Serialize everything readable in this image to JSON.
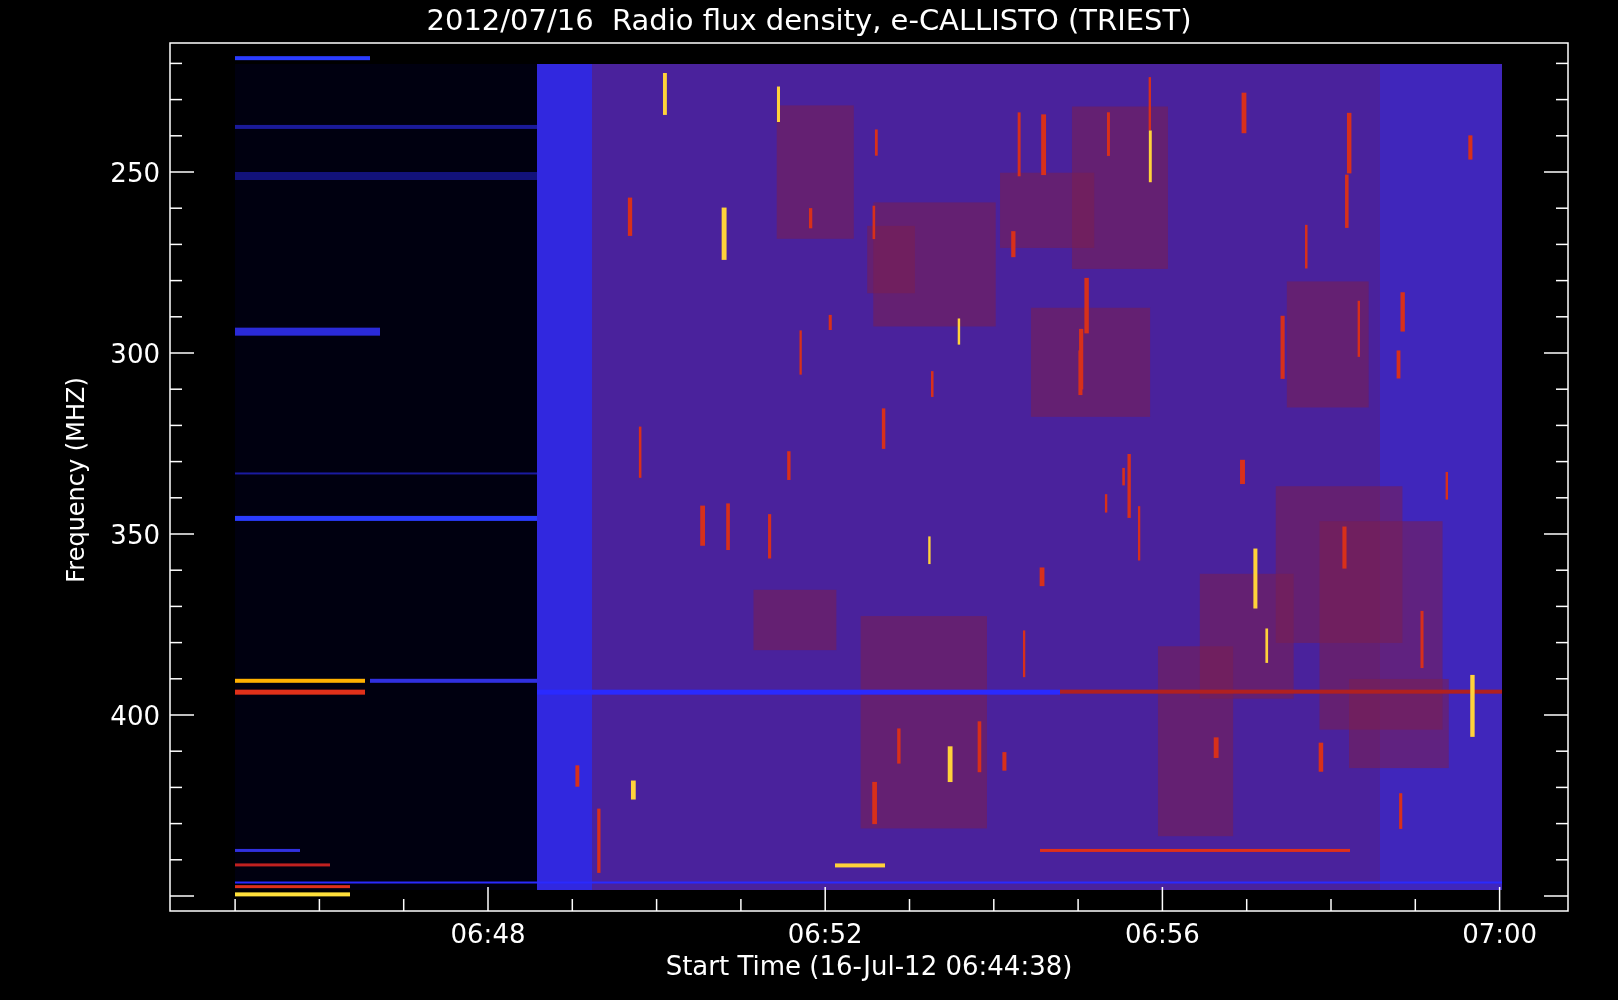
{
  "title": "2012/07/16  Radio flux density, e-CALLISTO (TRIEST)",
  "ylabel": "Frequency (MHZ)",
  "xlabel": "Start Time (16-Jul-12 06:44:38)",
  "yticks": [
    "250",
    "300",
    "350",
    "400"
  ],
  "xticks": [
    "06:48",
    "06:52",
    "06:56",
    "07:00"
  ]
}
